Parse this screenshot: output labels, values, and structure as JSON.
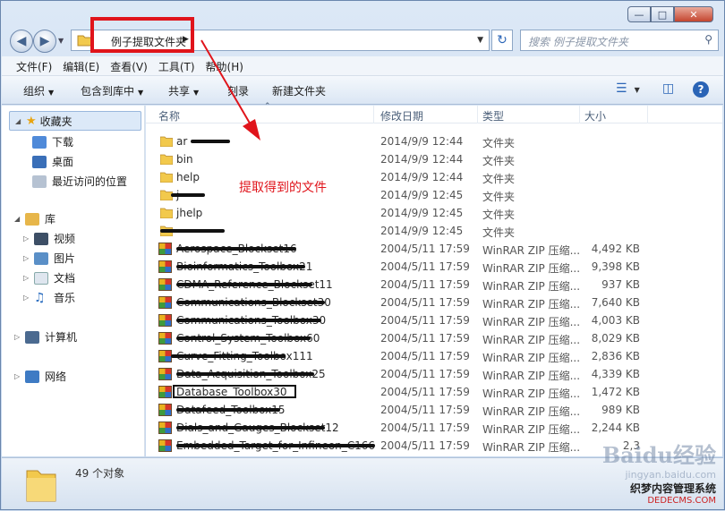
{
  "window": {
    "address": {
      "crumb": "例子提取文件夹"
    },
    "search": {
      "placeholder": "搜索 例子提取文件夹"
    }
  },
  "menu": [
    "文件(F)",
    "编辑(E)",
    "查看(V)",
    "工具(T)",
    "帮助(H)"
  ],
  "toolbar": {
    "organize": "组织",
    "include_library": "包含到库中",
    "share": "共享",
    "burn": "刻录",
    "new_folder": "新建文件夹"
  },
  "navpane": {
    "favorites": "收藏夹",
    "downloads": "下载",
    "desktop": "桌面",
    "recent": "最近访问的位置",
    "libraries": "库",
    "videos": "视频",
    "pictures": "图片",
    "documents": "文档",
    "music": "音乐",
    "computer": "计算机",
    "network": "网络"
  },
  "columns": {
    "name": "名称",
    "date": "修改日期",
    "type": "类型",
    "size": "大小"
  },
  "files": [
    {
      "name": "ar",
      "date": "2014/9/9 12:44",
      "type": "文件夹",
      "size": "",
      "kind": "folder"
    },
    {
      "name": "bin",
      "date": "2014/9/9 12:44",
      "type": "文件夹",
      "size": "",
      "kind": "folder"
    },
    {
      "name": "help",
      "date": "2014/9/9 12:44",
      "type": "文件夹",
      "size": "",
      "kind": "folder"
    },
    {
      "name": "j",
      "date": "2014/9/9 12:45",
      "type": "文件夹",
      "size": "",
      "kind": "folder"
    },
    {
      "name": "jhelp",
      "date": "2014/9/9 12:45",
      "type": "文件夹",
      "size": "",
      "kind": "folder"
    },
    {
      "name": "",
      "date": "2014/9/9 12:45",
      "type": "文件夹",
      "size": "",
      "kind": "folder"
    },
    {
      "name": "Aerospace_Blockset16",
      "date": "2004/5/11 17:59",
      "type": "WinRAR ZIP 压缩...",
      "size": "4,492 KB",
      "kind": "zip"
    },
    {
      "name": "Bioinformatics_Toolbox21",
      "date": "2004/5/11 17:59",
      "type": "WinRAR ZIP 压缩...",
      "size": "9,398 KB",
      "kind": "zip"
    },
    {
      "name": "CDMA_Reference_Blockset11",
      "date": "2004/5/11 17:59",
      "type": "WinRAR ZIP 压缩...",
      "size": "937 KB",
      "kind": "zip"
    },
    {
      "name": "Communications_Blockset30",
      "date": "2004/5/11 17:59",
      "type": "WinRAR ZIP 压缩...",
      "size": "7,640 KB",
      "kind": "zip"
    },
    {
      "name": "Communications_Toolbox30",
      "date": "2004/5/11 17:59",
      "type": "WinRAR ZIP 压缩...",
      "size": "4,003 KB",
      "kind": "zip"
    },
    {
      "name": "Control_System_Toolbox60",
      "date": "2004/5/11 17:59",
      "type": "WinRAR ZIP 压缩...",
      "size": "8,029 KB",
      "kind": "zip"
    },
    {
      "name": "Curve_Fitting_Toolbox111",
      "date": "2004/5/11 17:59",
      "type": "WinRAR ZIP 压缩...",
      "size": "2,836 KB",
      "kind": "zip"
    },
    {
      "name": "Data_Acquisition_Toolbox25",
      "date": "2004/5/11 17:59",
      "type": "WinRAR ZIP 压缩...",
      "size": "4,339 KB",
      "kind": "zip"
    },
    {
      "name": "Database_Toolbox30",
      "date": "2004/5/11 17:59",
      "type": "WinRAR ZIP 压缩...",
      "size": "1,472 KB",
      "kind": "zip"
    },
    {
      "name": "Datafeed_Toolbox15",
      "date": "2004/5/11 17:59",
      "type": "WinRAR ZIP 压缩...",
      "size": "989 KB",
      "kind": "zip"
    },
    {
      "name": "Dials_and_Gauges_Blockset12",
      "date": "2004/5/11 17:59",
      "type": "WinRAR ZIP 压缩...",
      "size": "2,244 KB",
      "kind": "zip"
    },
    {
      "name": "Embedded_Target_for_Infineon_C166",
      "date": "2004/5/11 17:59",
      "type": "WinRAR ZIP 压缩...",
      "size": "2,3",
      "kind": "zip"
    }
  ],
  "annotation": "提取得到的文件",
  "status": {
    "count": "49 个对象"
  },
  "watermark": {
    "logo": "Baidu经验",
    "url": "jingyan.baidu.com",
    "site": "织梦内容管理系统",
    "domain": "DEDECMS.COM"
  },
  "colors": {
    "annotation_red": "#e0141b",
    "folder_yellow": "#f2c94c"
  }
}
